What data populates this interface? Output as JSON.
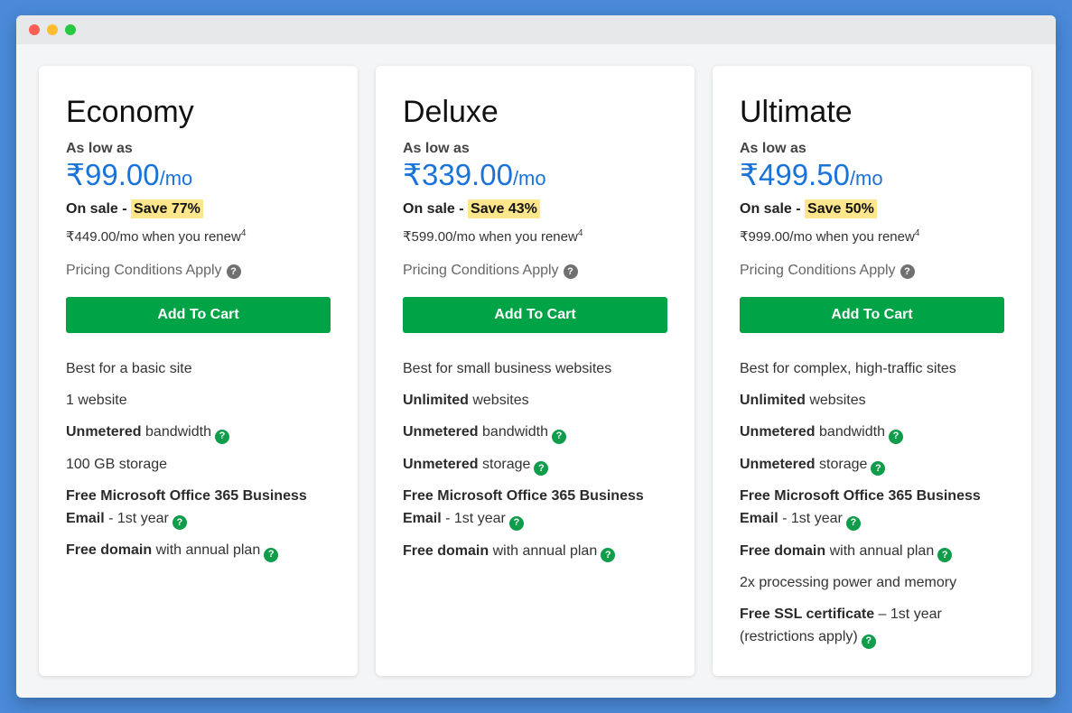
{
  "window": {
    "controls": [
      "close-dot",
      "minimize-dot",
      "maximize-dot"
    ]
  },
  "colors": {
    "accent_price": "#1a73d9",
    "cart_button": "#00a346",
    "save_highlight": "#fde68c",
    "help_icon_green": "#0f9d4b"
  },
  "plans": [
    {
      "name": "Economy",
      "as_low_as": "As low as",
      "price": "₹99.00",
      "per": "/mo",
      "on_sale": "On sale - ",
      "save": "Save 77%",
      "renew": "₹449.00/mo when you renew",
      "renew_sup": "4",
      "conditions": "Pricing Conditions Apply",
      "cart_label": "Add To Cart",
      "features": [
        {
          "bold": "",
          "text": "Best for a basic site",
          "help": false
        },
        {
          "bold": "",
          "text": "1 website",
          "help": false
        },
        {
          "bold": "Unmetered",
          "text": " bandwidth",
          "help": true
        },
        {
          "bold": "",
          "text": "100 GB storage",
          "help": false
        },
        {
          "bold": "Free Microsoft Office 365 Business Email",
          "text": " - 1st year",
          "help": true
        },
        {
          "bold": "Free domain",
          "text": " with annual plan",
          "help": true
        }
      ]
    },
    {
      "name": "Deluxe",
      "as_low_as": "As low as",
      "price": "₹339.00",
      "per": "/mo",
      "on_sale": "On sale - ",
      "save": "Save 43%",
      "renew": "₹599.00/mo when you renew",
      "renew_sup": "4",
      "conditions": "Pricing Conditions Apply",
      "cart_label": "Add To Cart",
      "features": [
        {
          "bold": "",
          "text": "Best for small business websites",
          "help": false
        },
        {
          "bold": "Unlimited",
          "text": " websites",
          "help": false
        },
        {
          "bold": "Unmetered",
          "text": " bandwidth",
          "help": true
        },
        {
          "bold": "Unmetered",
          "text": " storage",
          "help": true
        },
        {
          "bold": "Free Microsoft Office 365 Business Email",
          "text": " - 1st year",
          "help": true
        },
        {
          "bold": "Free domain",
          "text": " with annual plan",
          "help": true
        }
      ]
    },
    {
      "name": "Ultimate",
      "as_low_as": "As low as",
      "price": "₹499.50",
      "per": "/mo",
      "on_sale": "On sale - ",
      "save": "Save 50%",
      "renew": "₹999.00/mo when you renew",
      "renew_sup": "4",
      "conditions": "Pricing Conditions Apply",
      "cart_label": "Add To Cart",
      "features": [
        {
          "bold": "",
          "text": "Best for complex, high-traffic sites",
          "help": false
        },
        {
          "bold": "Unlimited",
          "text": " websites",
          "help": false
        },
        {
          "bold": "Unmetered",
          "text": " bandwidth",
          "help": true
        },
        {
          "bold": "Unmetered",
          "text": " storage",
          "help": true
        },
        {
          "bold": "Free Microsoft Office 365 Business Email",
          "text": " - 1st year",
          "help": true
        },
        {
          "bold": "Free domain",
          "text": " with annual plan",
          "help": true
        },
        {
          "bold": "",
          "text": "2x processing power and memory",
          "help": false
        },
        {
          "bold": "Free SSL certificate",
          "text": " – 1st year (restrictions apply)",
          "help": true
        }
      ]
    }
  ]
}
